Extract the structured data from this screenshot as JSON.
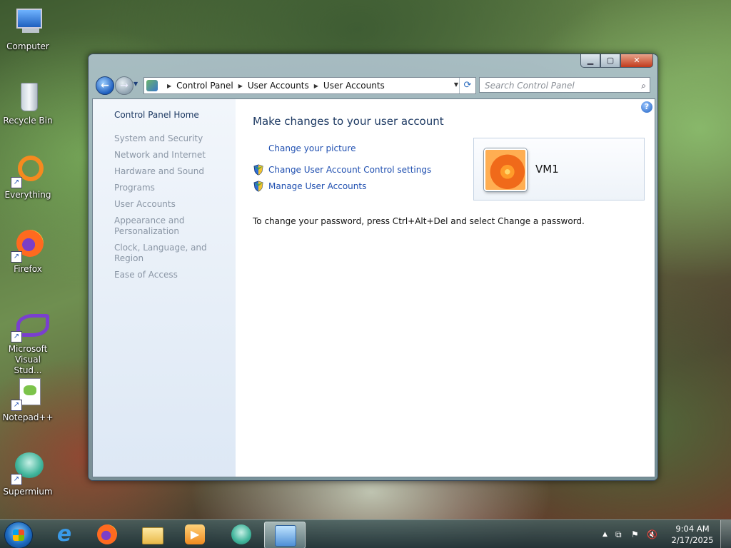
{
  "desktop": {
    "icons": [
      {
        "label": "Computer"
      },
      {
        "label": "Recycle Bin"
      },
      {
        "label": "Everything"
      },
      {
        "label": "Firefox"
      },
      {
        "label": "Microsoft Visual Stud..."
      },
      {
        "label": "Notepad++"
      },
      {
        "label": "Supermium"
      }
    ]
  },
  "window": {
    "address": {
      "segments": [
        "Control Panel",
        "User Accounts",
        "User Accounts"
      ]
    },
    "search": {
      "placeholder": "Search Control Panel"
    },
    "sidebar": {
      "home": "Control Panel Home",
      "items": [
        "System and Security",
        "Network and Internet",
        "Hardware and Sound",
        "Programs",
        "User Accounts",
        "Appearance and Personalization",
        "Clock, Language, and Region",
        "Ease of Access"
      ]
    },
    "main": {
      "heading": "Make changes to your user account",
      "tasks": [
        {
          "label": "Change your picture",
          "icon": "none"
        },
        {
          "label": "Change User Account Control settings",
          "icon": "uac-shield-icon"
        },
        {
          "label": "Manage User Accounts",
          "icon": "uac-shield-icon"
        }
      ],
      "password_message": "To change your password, press Ctrl+Alt+Del and select Change a password.",
      "account": {
        "name": "VM1"
      }
    }
  },
  "taskbar": {
    "clock": {
      "time": "9:04 AM",
      "date": "2/17/2025"
    }
  },
  "colors": {
    "link": "#1f4fb0",
    "heading": "#1e3a63",
    "sidebar_inactive": "#8a96a5"
  }
}
